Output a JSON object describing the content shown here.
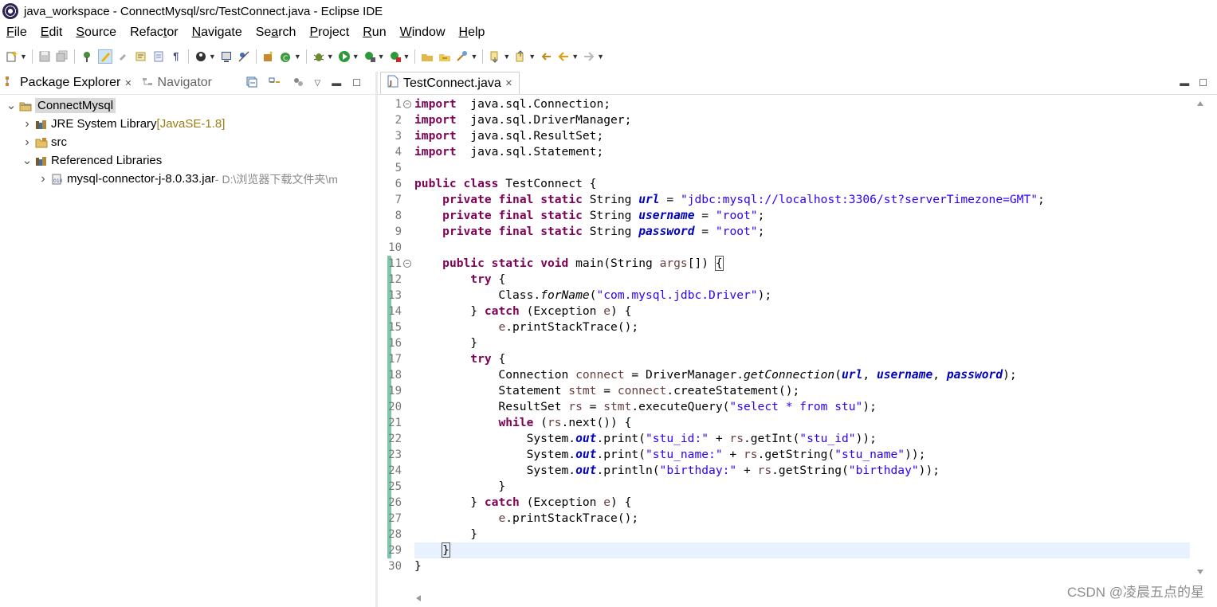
{
  "window": {
    "title": "java_workspace - ConnectMysql/src/TestConnect.java - Eclipse IDE"
  },
  "menu": [
    {
      "key": "F",
      "rest": "ile"
    },
    {
      "key": "E",
      "rest": "dit"
    },
    {
      "key": "S",
      "rest": "ource"
    },
    {
      "key": "",
      "rest": "Refac",
      "key2": "t",
      "rest2": "or"
    },
    {
      "key": "N",
      "rest": "avigate"
    },
    {
      "key": "",
      "rest": "Se",
      "key2": "a",
      "rest2": "rch"
    },
    {
      "key": "P",
      "rest": "roject"
    },
    {
      "key": "R",
      "rest": "un"
    },
    {
      "key": "W",
      "rest": "indow"
    },
    {
      "key": "H",
      "rest": "elp"
    }
  ],
  "left_view": {
    "tabs": [
      {
        "label": "Package Explorer",
        "active": true
      },
      {
        "label": "Navigator",
        "active": false
      }
    ],
    "tree": [
      {
        "label": "ConnectMysql",
        "deco": "",
        "level": 0,
        "expanded": true,
        "selected": true,
        "icon": "project-icon"
      },
      {
        "label": "JRE System Library",
        "deco": " [JavaSE-1.8]",
        "level": 1,
        "expanded": false,
        "icon": "library-icon"
      },
      {
        "label": "src",
        "deco": "",
        "level": 1,
        "expanded": false,
        "icon": "source-folder-icon"
      },
      {
        "label": "Referenced Libraries",
        "deco": "",
        "level": 1,
        "expanded": true,
        "icon": "library-icon"
      },
      {
        "label": "mysql-connector-j-8.0.33.jar",
        "deco": " - D:\\浏览器下载文件夹\\m",
        "level": 2,
        "expanded": false,
        "icon": "jar-icon"
      }
    ]
  },
  "editor": {
    "tab_label": "TestConnect.java",
    "current_line": 29,
    "line_numbers": [
      "1",
      "2",
      "3",
      "4",
      "5",
      "6",
      "7",
      "8",
      "9",
      "10",
      "11",
      "12",
      "13",
      "14",
      "15",
      "16",
      "17",
      "18",
      "19",
      "20",
      "21",
      "22",
      "23",
      "24",
      "25",
      "26",
      "27",
      "28",
      "29",
      "30"
    ],
    "folds": [
      1,
      11
    ],
    "lines": [
      [
        [
          "kw",
          "import"
        ],
        [
          "",
          "  java.sql.Connection;"
        ]
      ],
      [
        [
          "kw",
          "import"
        ],
        [
          "",
          "  java.sql.DriverManager;"
        ]
      ],
      [
        [
          "kw",
          "import"
        ],
        [
          "",
          "  java.sql.ResultSet;"
        ]
      ],
      [
        [
          "kw",
          "import"
        ],
        [
          "",
          "  java.sql.Statement;"
        ]
      ],
      [],
      [
        [
          "kw",
          "public"
        ],
        [
          "",
          " "
        ],
        [
          "kw",
          "class"
        ],
        [
          "",
          " TestConnect {"
        ]
      ],
      [
        [
          "",
          "    "
        ],
        [
          "kw",
          "private"
        ],
        [
          "",
          " "
        ],
        [
          "kw",
          "final"
        ],
        [
          "",
          " "
        ],
        [
          "kw",
          "static"
        ],
        [
          "",
          " String "
        ],
        [
          "fld",
          "url"
        ],
        [
          "",
          " = "
        ],
        [
          "str",
          "\"jdbc:mysql://localhost:3306/st?serverTimezone=GMT\""
        ],
        [
          "",
          ";"
        ]
      ],
      [
        [
          "",
          "    "
        ],
        [
          "kw",
          "private"
        ],
        [
          "",
          " "
        ],
        [
          "kw",
          "final"
        ],
        [
          "",
          " "
        ],
        [
          "kw",
          "static"
        ],
        [
          "",
          " String "
        ],
        [
          "fld",
          "username"
        ],
        [
          "",
          " = "
        ],
        [
          "str",
          "\"root\""
        ],
        [
          "",
          ";"
        ]
      ],
      [
        [
          "",
          "    "
        ],
        [
          "kw",
          "private"
        ],
        [
          "",
          " "
        ],
        [
          "kw",
          "final"
        ],
        [
          "",
          " "
        ],
        [
          "kw",
          "static"
        ],
        [
          "",
          " String "
        ],
        [
          "fld",
          "password"
        ],
        [
          "",
          " = "
        ],
        [
          "str",
          "\"root\""
        ],
        [
          "",
          ";"
        ]
      ],
      [],
      [
        [
          "",
          "    "
        ],
        [
          "kw",
          "public"
        ],
        [
          "",
          " "
        ],
        [
          "kw",
          "static"
        ],
        [
          "",
          " "
        ],
        [
          "kw",
          "void"
        ],
        [
          "",
          " main(String "
        ],
        [
          "lv",
          "args"
        ],
        [
          "",
          "[]) "
        ],
        [
          "box",
          "{"
        ]
      ],
      [
        [
          "",
          "        "
        ],
        [
          "kw",
          "try"
        ],
        [
          "",
          " {"
        ]
      ],
      [
        [
          "",
          "            Class."
        ],
        [
          "ital",
          "forName"
        ],
        [
          "",
          "("
        ],
        [
          "str",
          "\"com.mysql.jdbc.Driver\""
        ],
        [
          "",
          ");"
        ]
      ],
      [
        [
          "",
          "        } "
        ],
        [
          "kw",
          "catch"
        ],
        [
          "",
          " (Exception "
        ],
        [
          "lv",
          "e"
        ],
        [
          "",
          ") {"
        ]
      ],
      [
        [
          "",
          "            "
        ],
        [
          "lv",
          "e"
        ],
        [
          "",
          ".printStackTrace();"
        ]
      ],
      [
        [
          "",
          "        }"
        ]
      ],
      [
        [
          "",
          "        "
        ],
        [
          "kw",
          "try"
        ],
        [
          "",
          " {"
        ]
      ],
      [
        [
          "",
          "            Connection "
        ],
        [
          "lv",
          "connect"
        ],
        [
          "",
          " = DriverManager."
        ],
        [
          "ital",
          "getConnection"
        ],
        [
          "",
          "("
        ],
        [
          "fld",
          "url"
        ],
        [
          "",
          ", "
        ],
        [
          "fld",
          "username"
        ],
        [
          "",
          ", "
        ],
        [
          "fld",
          "password"
        ],
        [
          "",
          ");"
        ]
      ],
      [
        [
          "",
          "            Statement "
        ],
        [
          "lv",
          "stmt"
        ],
        [
          "",
          " = "
        ],
        [
          "lv",
          "connect"
        ],
        [
          "",
          ".createStatement();"
        ]
      ],
      [
        [
          "",
          "            ResultSet "
        ],
        [
          "lv",
          "rs"
        ],
        [
          "",
          " = "
        ],
        [
          "lv",
          "stmt"
        ],
        [
          "",
          ".executeQuery("
        ],
        [
          "str",
          "\"select * from stu\""
        ],
        [
          "",
          ");"
        ]
      ],
      [
        [
          "",
          "            "
        ],
        [
          "kw",
          "while"
        ],
        [
          "",
          " ("
        ],
        [
          "lv",
          "rs"
        ],
        [
          "",
          ".next()) {"
        ]
      ],
      [
        [
          "",
          "                System."
        ],
        [
          "fld",
          "out"
        ],
        [
          "",
          ".print("
        ],
        [
          "str",
          "\"stu_id:\""
        ],
        [
          "",
          " + "
        ],
        [
          "lv",
          "rs"
        ],
        [
          "",
          ".getInt("
        ],
        [
          "str",
          "\"stu_id\""
        ],
        [
          "",
          "));"
        ]
      ],
      [
        [
          "",
          "                System."
        ],
        [
          "fld",
          "out"
        ],
        [
          "",
          ".print("
        ],
        [
          "str",
          "\"stu_name:\""
        ],
        [
          "",
          " + "
        ],
        [
          "lv",
          "rs"
        ],
        [
          "",
          ".getString("
        ],
        [
          "str",
          "\"stu_name\""
        ],
        [
          "",
          "));"
        ]
      ],
      [
        [
          "",
          "                System."
        ],
        [
          "fld",
          "out"
        ],
        [
          "",
          ".println("
        ],
        [
          "str",
          "\"birthday:\""
        ],
        [
          "",
          " + "
        ],
        [
          "lv",
          "rs"
        ],
        [
          "",
          ".getString("
        ],
        [
          "str",
          "\"birthday\""
        ],
        [
          "",
          "));"
        ]
      ],
      [
        [
          "",
          "            }"
        ]
      ],
      [
        [
          "",
          "        } "
        ],
        [
          "kw",
          "catch"
        ],
        [
          "",
          " (Exception "
        ],
        [
          "lv",
          "e"
        ],
        [
          "",
          ") {"
        ]
      ],
      [
        [
          "",
          "            "
        ],
        [
          "lv",
          "e"
        ],
        [
          "",
          ".printStackTrace();"
        ]
      ],
      [
        [
          "",
          "        }"
        ]
      ],
      [
        [
          "",
          "    "
        ],
        [
          "box",
          "}"
        ]
      ],
      [
        [
          "",
          "}"
        ]
      ]
    ]
  },
  "watermark": "CSDN @凌晨五点的星",
  "colors": {
    "keyword": "#7f0055",
    "string": "#2a00ff",
    "field": "#0000c0",
    "current_line": "#e8f2fe",
    "change_bar": "#7cc6a9"
  }
}
